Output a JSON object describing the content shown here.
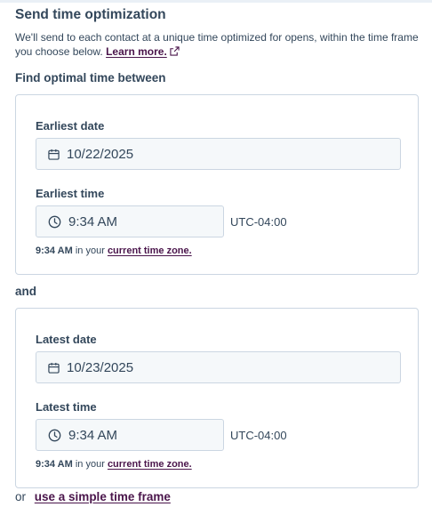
{
  "header": {
    "title": "Send time optimization",
    "description": "We'll send to each contact at a unique time optimized for opens, within the time frame you choose below.",
    "learn_more": "Learn more."
  },
  "find_label": "Find optimal time between",
  "start": {
    "date_label": "Earliest date",
    "date_value": "10/22/2025",
    "time_label": "Earliest time",
    "time_value": "9:34 AM",
    "timezone": "UTC-04:00",
    "hint_time": "9:34 AM",
    "hint_middle": "in your",
    "hint_link": "current time zone."
  },
  "and_label": "and",
  "end": {
    "date_label": "Latest date",
    "date_value": "10/23/2025",
    "time_label": "Latest time",
    "time_value": "9:34 AM",
    "timezone": "UTC-04:00",
    "hint_time": "9:34 AM",
    "hint_middle": "in your",
    "hint_link": "current time zone."
  },
  "footer": {
    "or_text": "or",
    "simple_link": "use a simple time frame"
  },
  "colors": {
    "text": "#33475b",
    "link": "#4a154b",
    "border": "#cbd6e2",
    "input_bg": "#f5f8fa"
  },
  "icons": {
    "calendar": "calendar-icon",
    "clock": "clock-icon",
    "external": "external-link-icon"
  }
}
